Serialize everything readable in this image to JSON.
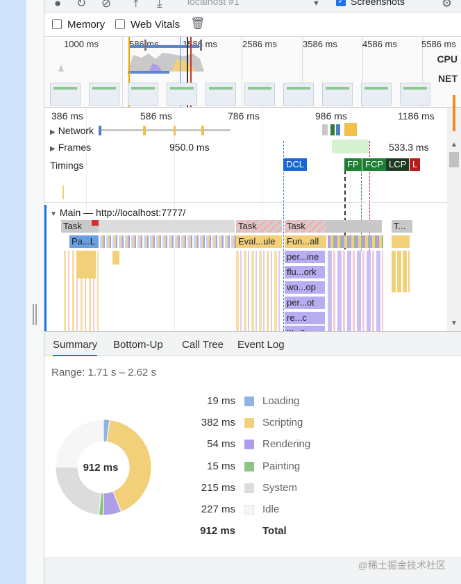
{
  "toolbar": {
    "url_select": "localhost #1",
    "screenshots_label": "Screenshots"
  },
  "options": {
    "memory_label": "Memory",
    "web_vitals_label": "Web Vitals"
  },
  "overview": {
    "ticks": [
      "1000 ms",
      "586 ms",
      "1586 ms",
      "2586 ms",
      "3586 ms",
      "4586 ms",
      "5586 ms"
    ],
    "cpu_label": "CPU",
    "net_label": "NET"
  },
  "timeline": {
    "ticks": [
      "386 ms",
      "586 ms",
      "786 ms",
      "986 ms",
      "1186 ms"
    ],
    "network_label": "Network",
    "frames_label": "Frames",
    "frame_duration_1": "950.0 ms",
    "frame_duration_2": "533.3 ms",
    "timings_label": "Timings",
    "markers": {
      "dcl": "DCL",
      "fp": "FP",
      "fcp": "FCP",
      "lcp": "LCP",
      "l": "L"
    },
    "main_label": "Main — http://localhost:7777/",
    "flame": {
      "task1": "Task",
      "task2": "Task",
      "task3": "Task",
      "task4": "T...",
      "pal": "Pa...L",
      "evalule": "Eval...ule",
      "funall": "Fun...all",
      "perine": "per...ine",
      "fluork": "flu...ork",
      "woop": "wo...op",
      "perot": "per...ot",
      "rec": "re...c",
      "wc": "w...c"
    }
  },
  "tabs": [
    "Summary",
    "Bottom-Up",
    "Call Tree",
    "Event Log"
  ],
  "summary": {
    "range": "Range: 1.71 s – 2.62 s",
    "total_center": "912 ms",
    "rows": [
      {
        "value": "19 ms",
        "name": "Loading",
        "color": "#8fb4e3"
      },
      {
        "value": "382 ms",
        "name": "Scripting",
        "color": "#f2d07a"
      },
      {
        "value": "54 ms",
        "name": "Rendering",
        "color": "#ae9ee9"
      },
      {
        "value": "15 ms",
        "name": "Painting",
        "color": "#8fc285"
      },
      {
        "value": "215 ms",
        "name": "System",
        "color": "#dcdcdc"
      },
      {
        "value": "227 ms",
        "name": "Idle",
        "color": "#f6f6f6"
      }
    ],
    "total": {
      "value": "912 ms",
      "name": "Total"
    }
  },
  "watermark": "@稀土掘金技术社区"
}
